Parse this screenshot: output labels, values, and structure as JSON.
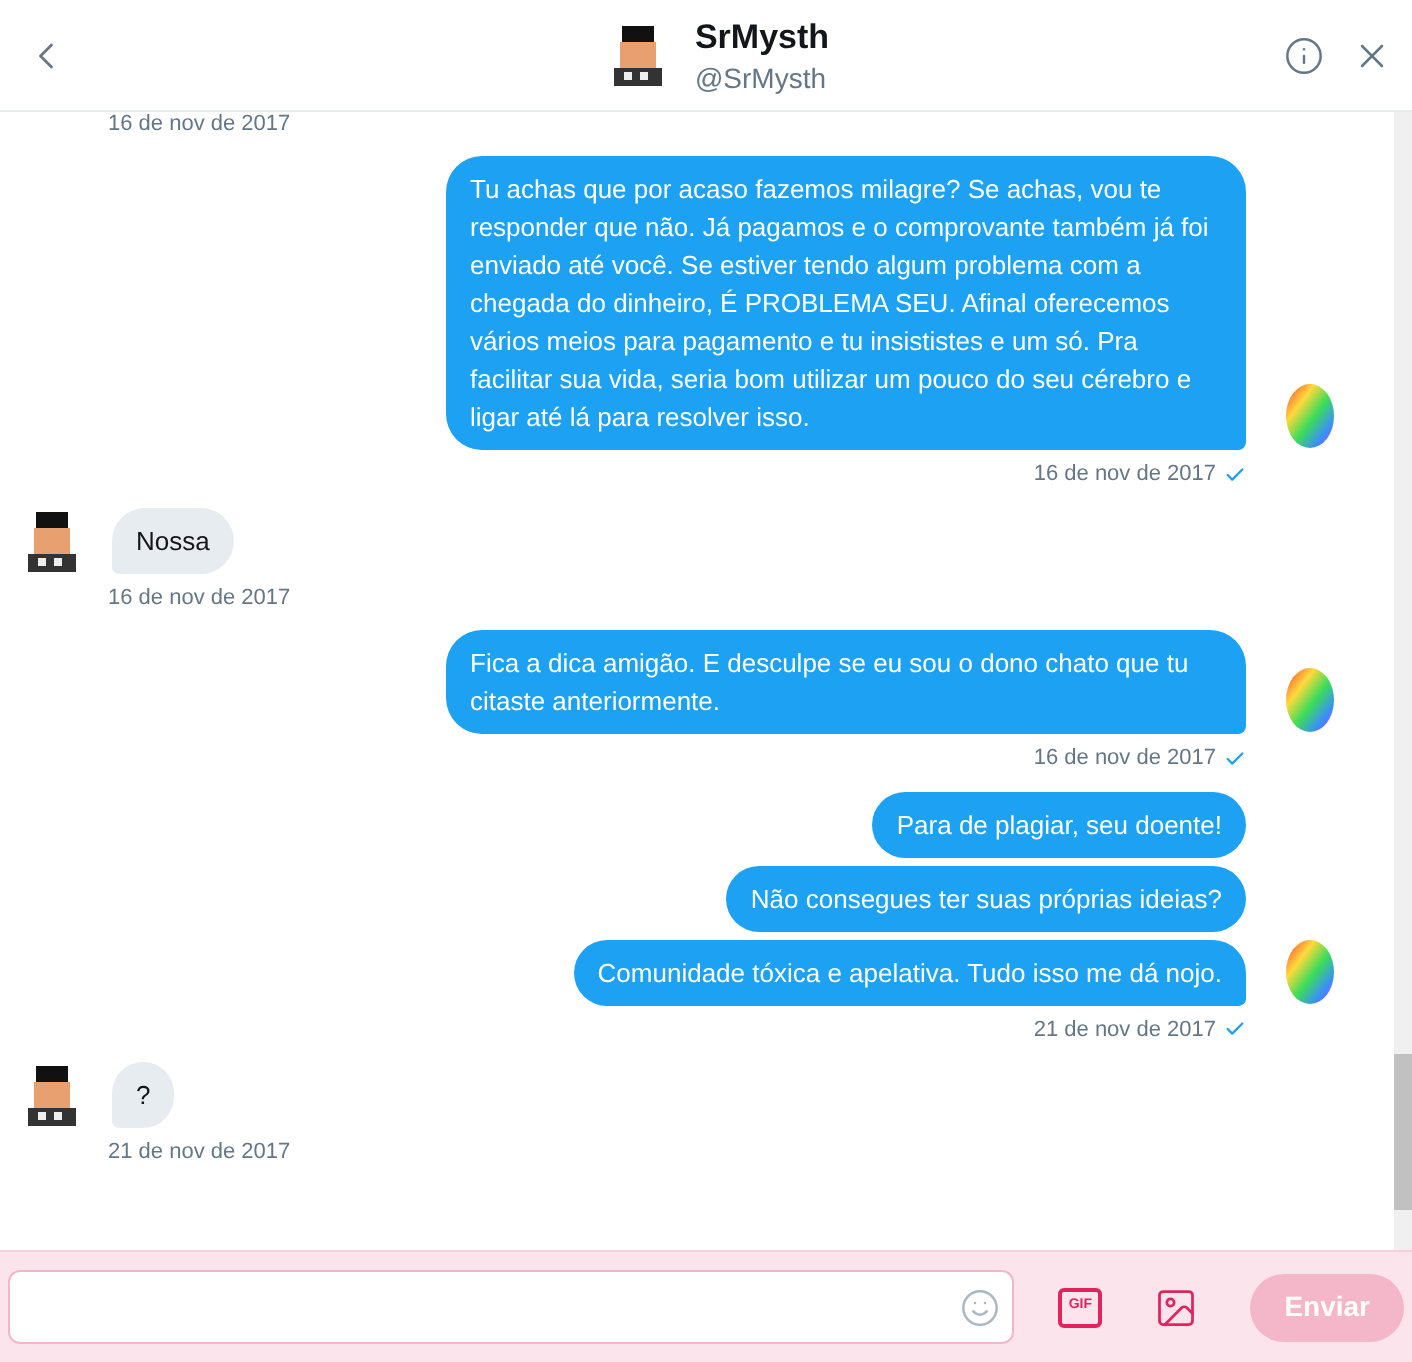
{
  "header": {
    "name": "SrMysth",
    "handle": "@SrMysth"
  },
  "cut_date": "16 de nov de 2017",
  "messages": [
    {
      "kind": "outgoing",
      "bubbles": [
        "Tu achas que por acaso fazemos milagre? Se achas, vou te responder que não. Já pagamos e o comprovante também já foi enviado até você. Se estiver tendo algum problema com a chegada do dinheiro, É PROBLEMA SEU. Afinal oferecemos vários meios para pagamento e tu insististes e um só. Pra facilitar sua vida, seria bom utilizar um pouco do seu cérebro e ligar até lá para resolver isso."
      ],
      "date": "16 de nov de 2017",
      "read": true
    },
    {
      "kind": "incoming",
      "bubbles": [
        "Nossa"
      ],
      "date": "16 de nov de 2017"
    },
    {
      "kind": "outgoing",
      "bubbles": [
        "Fica a dica amigão. E desculpe se eu sou o dono chato que tu citaste anteriormente."
      ],
      "date": "16 de nov de 2017",
      "read": true
    },
    {
      "kind": "outgoing",
      "bubbles": [
        "Para de plagiar, seu doente!",
        "Não consegues ter suas próprias ideias?",
        "Comunidade tóxica e apelativa. Tudo isso me dá nojo."
      ],
      "date": "21 de nov de 2017",
      "read": true
    },
    {
      "kind": "incoming",
      "bubbles": [
        "?"
      ],
      "date": "21 de nov de 2017"
    }
  ],
  "composer": {
    "gif_label": "GIF",
    "send_label": "Enviar",
    "send_disabled": true
  }
}
